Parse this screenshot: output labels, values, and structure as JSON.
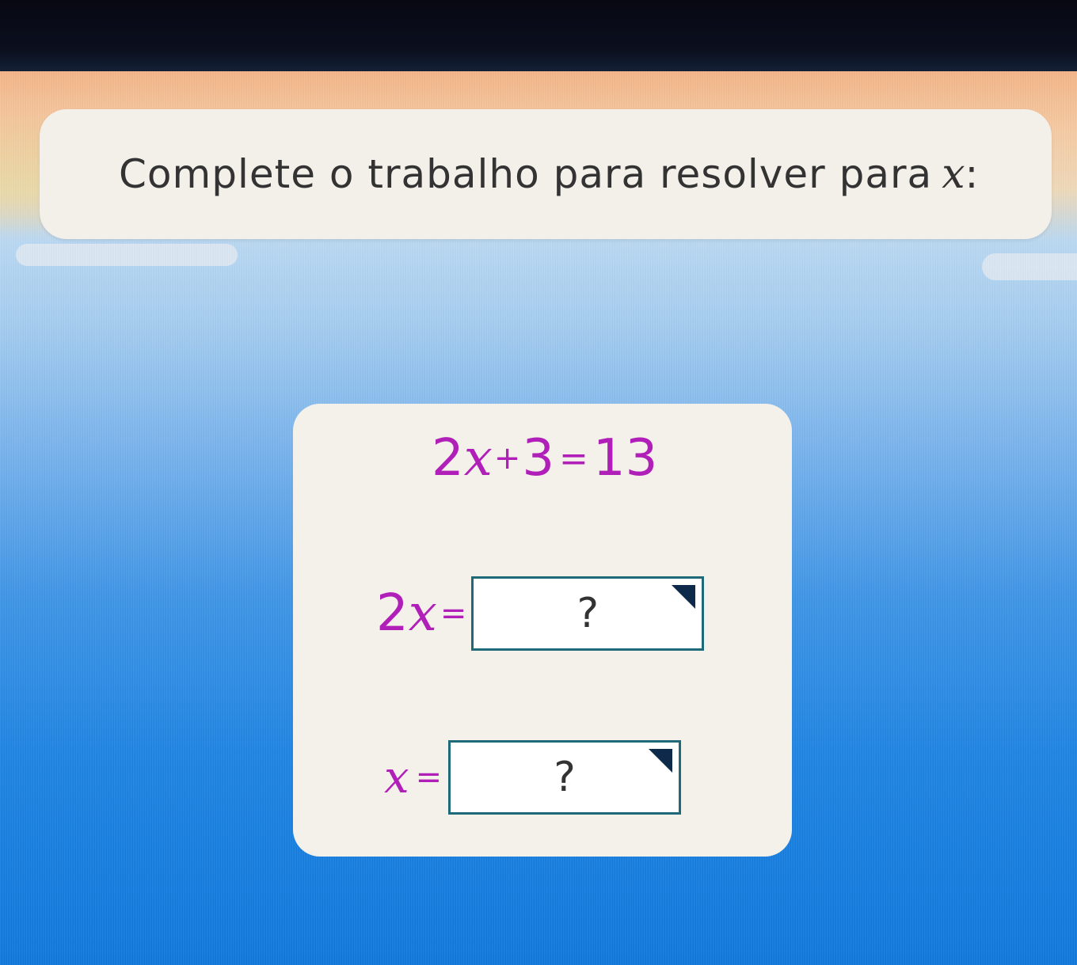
{
  "instruction": {
    "text": "Complete o trabalho para resolver para",
    "variable": "x",
    "suffix": ":"
  },
  "equation": {
    "coef": "2",
    "var": "x",
    "plus": "+",
    "const": "3",
    "equals": "=",
    "rhs": "13"
  },
  "step1": {
    "lhs_coef": "2",
    "lhs_var": "x",
    "equals": "=",
    "answer_placeholder": "?"
  },
  "step2": {
    "lhs_var": "x",
    "equals": "=",
    "answer_placeholder": "?"
  },
  "colors": {
    "math_accent": "#b020b8",
    "box_border": "#1e6a78",
    "card_bg": "#f4f0ea"
  },
  "icons": {
    "dropdown": "dropdown-triangle-icon"
  }
}
